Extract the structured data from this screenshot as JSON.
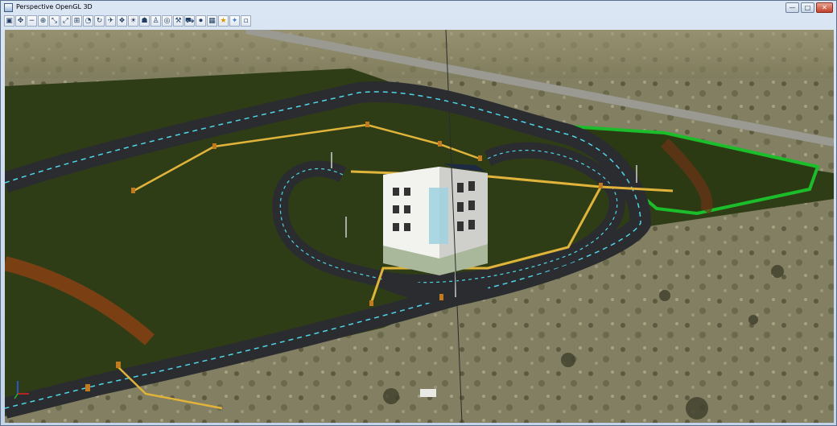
{
  "window": {
    "title": "Perspective OpenGL 3D",
    "minimize": "—",
    "maximize": "□",
    "close": "✕"
  },
  "toolbar": {
    "buttons": [
      {
        "name": "view-settings-icon",
        "glyph": "▣"
      },
      {
        "name": "pan-icon",
        "glyph": "✥"
      },
      {
        "name": "zoom-out-icon",
        "glyph": "−"
      },
      {
        "name": "zoom-in-icon",
        "glyph": "⊕"
      },
      {
        "name": "zoom-area-icon",
        "glyph": "⤡"
      },
      {
        "name": "fit-view-icon",
        "glyph": "⤢"
      },
      {
        "name": "zoom-window-icon",
        "glyph": "⊞"
      },
      {
        "name": "zoom-previous-icon",
        "glyph": "◔"
      },
      {
        "name": "rotate-icon",
        "glyph": "↻"
      },
      {
        "name": "fly-through-icon",
        "glyph": "✈"
      },
      {
        "name": "render-icon",
        "glyph": "❖"
      },
      {
        "name": "lighting-icon",
        "glyph": "☀"
      },
      {
        "name": "walk-icon",
        "glyph": "☗"
      },
      {
        "name": "person-icon",
        "glyph": "♙"
      },
      {
        "name": "steering-icon",
        "glyph": "◎"
      },
      {
        "name": "tools-icon",
        "glyph": "⚒"
      },
      {
        "name": "drive-icon",
        "glyph": "⛟"
      },
      {
        "name": "record-icon",
        "glyph": "⏺"
      },
      {
        "name": "materials-icon",
        "glyph": "▦"
      },
      {
        "name": "favorites-icon",
        "glyph": "★"
      },
      {
        "name": "bookmark-star-icon",
        "glyph": "✦"
      },
      {
        "name": "options-icon",
        "glyph": "▫"
      }
    ]
  },
  "colors": {
    "titlebar": "#c7d6ea",
    "field": "#2f3d17",
    "road": "#2a2c30",
    "road_marking": "#4fd6e8",
    "pipe": "#e0b43a",
    "terrain": "#8a8866"
  }
}
